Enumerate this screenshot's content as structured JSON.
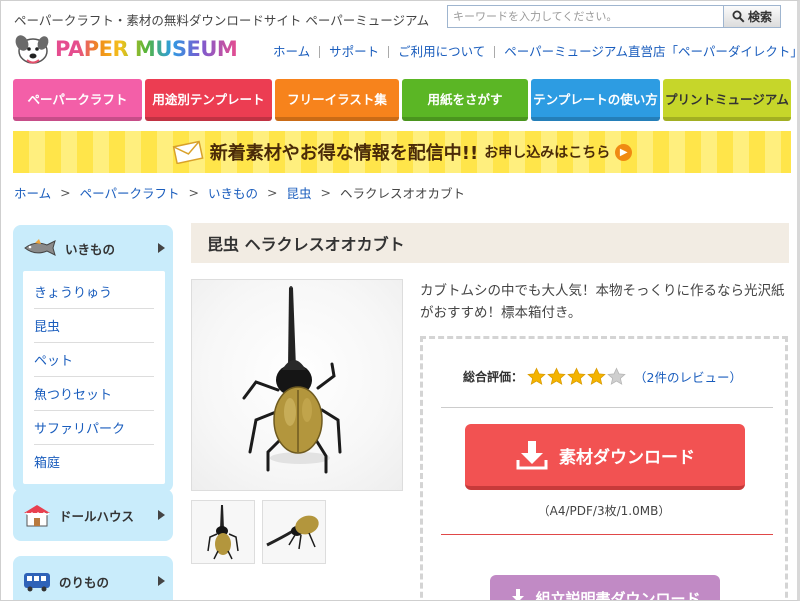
{
  "header": {
    "tagline": "ペーパークラフト・素材の無料ダウンロードサイト ペーパーミュージアム",
    "search_placeholder": "キーワードを入力してください。",
    "search_button": "検索",
    "logo_text": "PAPER MUSEUM",
    "links": [
      "ホーム",
      "サポート",
      "ご利用について",
      "ペーパーミュージアム直営店「ペーパーダイレクト」"
    ]
  },
  "nav": {
    "items": [
      {
        "label": "ペーパークラフト",
        "color": "#f35fa8"
      },
      {
        "label": "用途別テンプレート",
        "color": "#ec3d52"
      },
      {
        "label": "フリーイラスト集",
        "color": "#f7831c"
      },
      {
        "label": "用紙をさがす",
        "color": "#5bb625"
      },
      {
        "label": "テンプレートの使い方",
        "color": "#2d9ce2"
      },
      {
        "label": "プリントミュージアム",
        "color": "#c6d62a"
      }
    ]
  },
  "banner": {
    "main": "新着素材やお得な情報を配信中!!",
    "sub": "お申し込みはこちら"
  },
  "breadcrumb": {
    "items": [
      "ホーム",
      "ペーパークラフト",
      "いきもの",
      "昆虫"
    ],
    "current": "ヘラクレスオオカブト",
    "separator": ">"
  },
  "sidebar": {
    "sections": [
      {
        "label": "いきもの",
        "icon": "fish-icon",
        "items": [
          "きょうりゅう",
          "昆虫",
          "ペット",
          "魚つりセット",
          "サファリパーク",
          "箱庭"
        ]
      },
      {
        "label": "ドールハウス",
        "icon": "house-icon"
      },
      {
        "label": "のりもの",
        "icon": "bus-icon"
      }
    ]
  },
  "product": {
    "title": "昆虫 ヘラクレスオオカブト",
    "description": "カブトムシの中でも大人気！本物そっくりに作るなら光沢紙がおすすめ！標本箱付き。",
    "rating_label": "総合評価：",
    "rating": 4,
    "rating_max": 5,
    "reviews": "（2件のレビュー）",
    "download_label": "素材ダウンロード",
    "download_meta": "（A4/PDF/3枚/1.0MB）",
    "instructions_label": "組立説明書ダウンロード"
  },
  "colors": {
    "link": "#1a5dbd",
    "download_button": "#f25252",
    "instructions_button": "#c18ac5",
    "sidebar_bg": "#c9ecfb",
    "title_bar_bg": "#f2ece3",
    "star": "#f4b400"
  }
}
